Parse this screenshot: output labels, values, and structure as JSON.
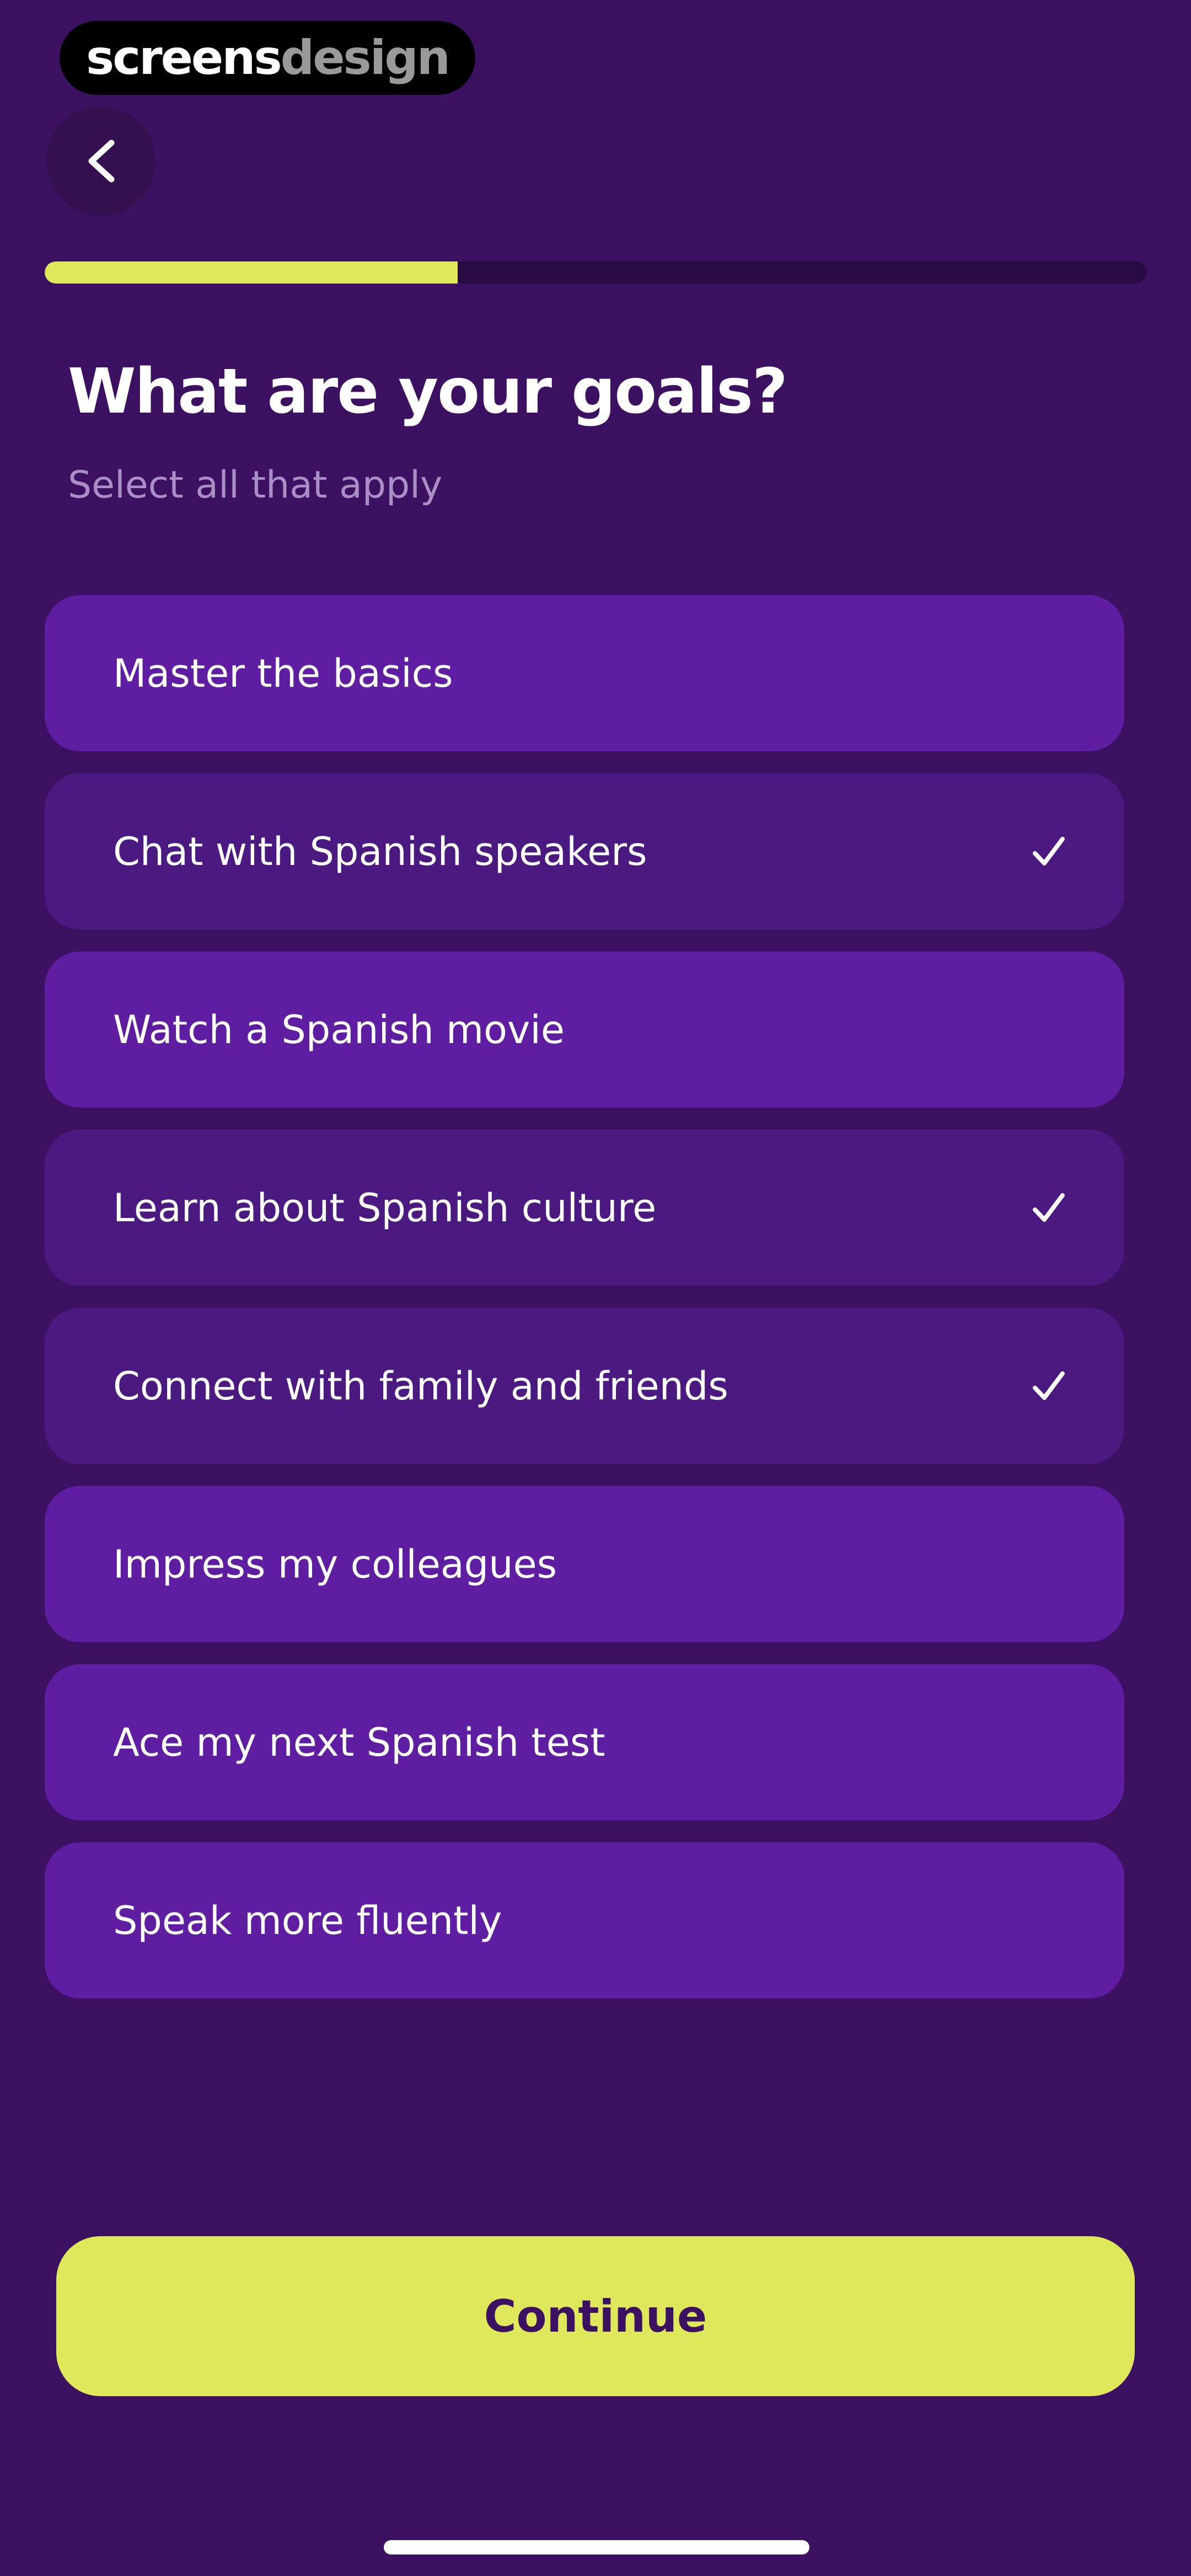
{
  "watermark": {
    "part1": "screens",
    "part2": "design"
  },
  "header": {
    "back_icon": "chevron-left-icon"
  },
  "progress": {
    "fraction": 0.375,
    "colors": {
      "fill": "#dfe85a",
      "track": "#280a42"
    }
  },
  "title": "What are your goals?",
  "subtitle": "Select all that apply",
  "options": [
    {
      "label": "Master the basics",
      "selected": false
    },
    {
      "label": "Chat with Spanish speakers",
      "selected": true
    },
    {
      "label": "Watch a Spanish movie",
      "selected": false
    },
    {
      "label": "Learn about Spanish culture",
      "selected": true
    },
    {
      "label": "Connect with family and friends",
      "selected": true
    },
    {
      "label": "Impress my colleagues",
      "selected": false
    },
    {
      "label": "Ace my next Spanish test",
      "selected": false
    },
    {
      "label": "Speak more fluently",
      "selected": false
    }
  ],
  "continue_label": "Continue",
  "colors": {
    "background": "#3d1162",
    "option": "#5f1ea2",
    "option_selected": "#4b1a80",
    "accent": "#dfe85a"
  }
}
